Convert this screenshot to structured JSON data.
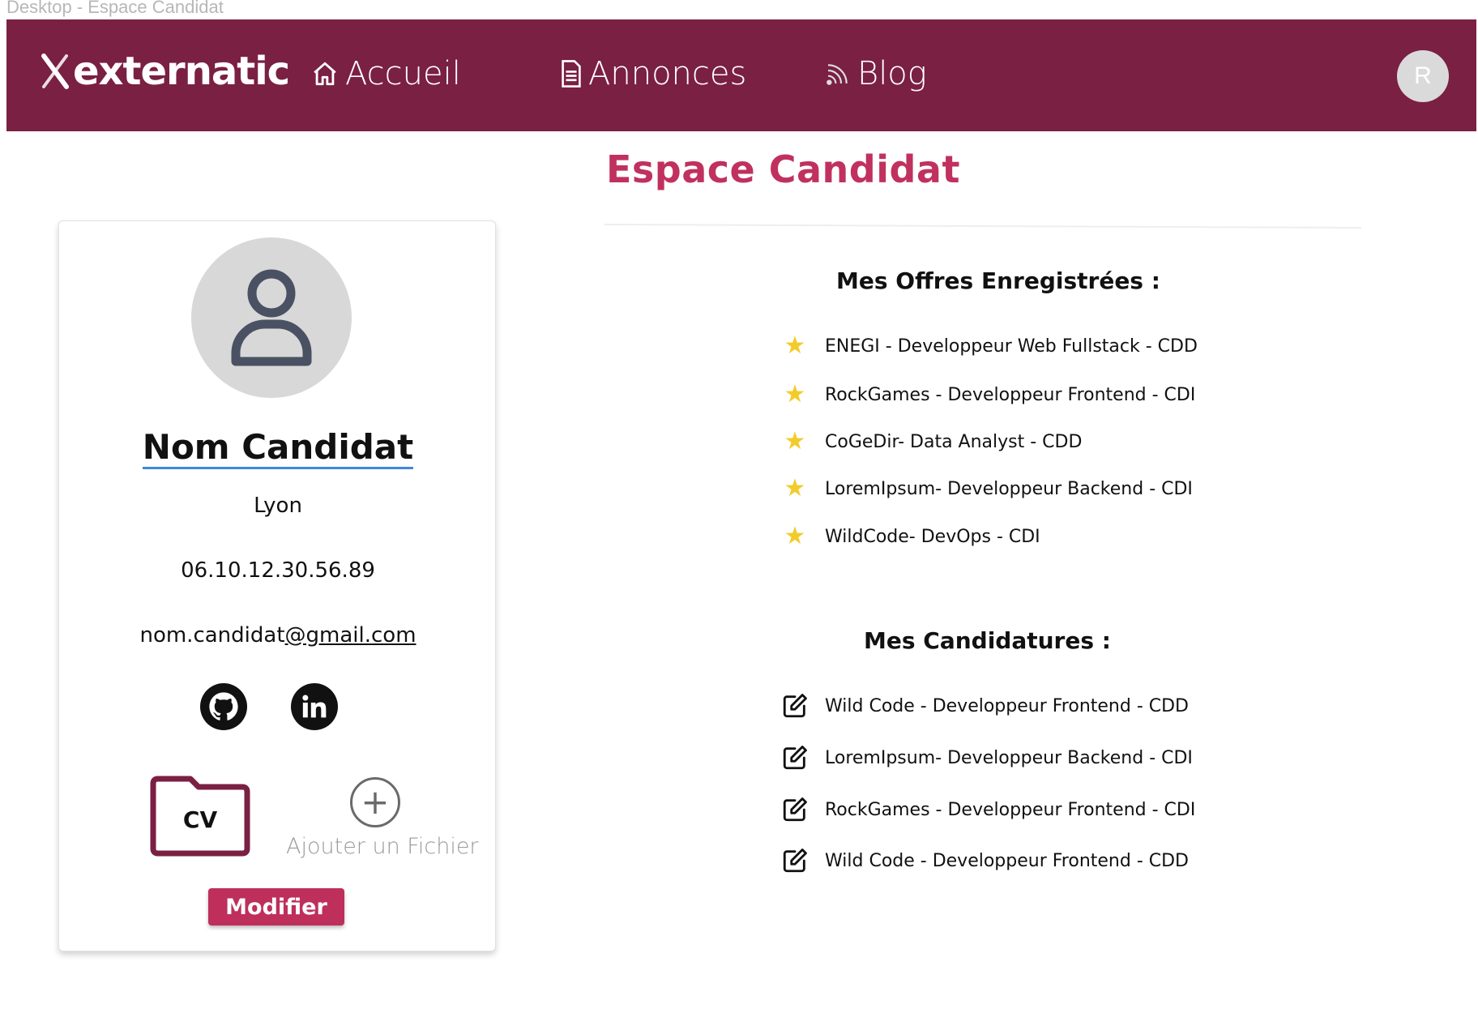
{
  "window": {
    "title": "Desktop - Espace Candidat"
  },
  "nav": {
    "brand": "externatic",
    "items": [
      {
        "label": "Accueil",
        "icon": "home-icon"
      },
      {
        "label": "Annonces",
        "icon": "document-icon"
      },
      {
        "label": "Blog",
        "icon": "rss-icon"
      }
    ],
    "user_initial": "R"
  },
  "page": {
    "title": "Espace Candidat"
  },
  "profile": {
    "name": "Nom Candidat",
    "city": "Lyon",
    "phone": "06.10.12.30.56.89",
    "email_local": "nom.candidat",
    "email_domain": "@gmail.com",
    "social": [
      "github-icon",
      "linkedin-icon"
    ],
    "cv_label": "CV",
    "add_file_label": "Ajouter un Fichier",
    "modify_label": "Modifier"
  },
  "saved_offers": {
    "title": "Mes Offres Enregistrées :",
    "items": [
      "ENEGI - Developpeur Web Fullstack - CDD",
      "RockGames - Developpeur Frontend - CDI",
      "CoGeDir- Data Analyst - CDD",
      "LoremIpsum- Developpeur Backend - CDI",
      "WildCode- DevOps - CDI"
    ]
  },
  "applications": {
    "title": "Mes Candidatures :",
    "items": [
      "Wild Code - Developpeur Frontend - CDD",
      "LoremIpsum- Developpeur Backend - CDI",
      "RockGames - Developpeur Frontend - CDI",
      "Wild Code - Developpeur Frontend - CDD"
    ]
  },
  "colors": {
    "nav_bg": "#7a2042",
    "accent": "#c0315f",
    "star": "#f2cc2a",
    "link_underline": "#3f86e0"
  }
}
